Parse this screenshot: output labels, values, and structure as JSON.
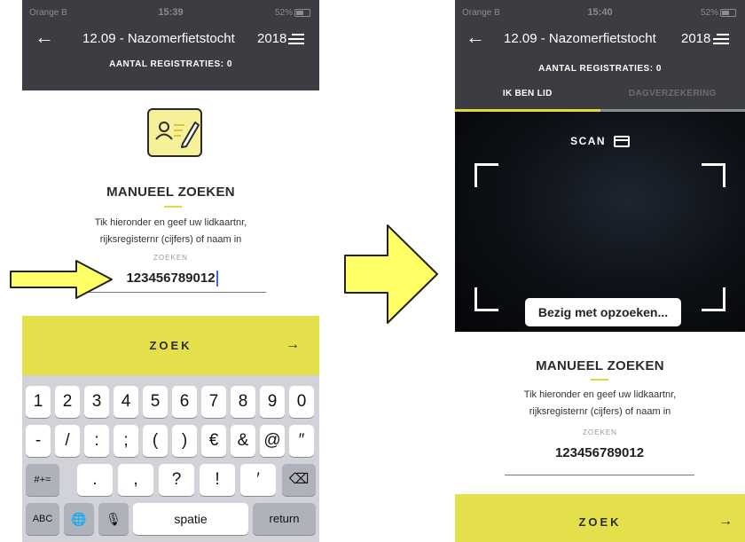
{
  "left_screen": {
    "status_bar": {
      "carrier": "Orange B",
      "time": "15:39",
      "battery": "52%"
    },
    "header": {
      "title": "12.09 - Nazomerfietstocht",
      "year": "2018",
      "registrations": "AANTAL REGISTRATIES: 0"
    },
    "manual_search": {
      "title": "MANUEEL ZOEKEN",
      "help_line1": "Tik hieronder en geef uw lidkaartnr,",
      "help_line2": "rijksregisternr (cijfers) of naam in",
      "field_label": "ZOEKEN",
      "field_value": "123456789012"
    },
    "search_button": {
      "label": "ZOEK",
      "arrow": "→"
    },
    "keyboard": {
      "row1": [
        "1",
        "2",
        "3",
        "4",
        "5",
        "6",
        "7",
        "8",
        "9",
        "0"
      ],
      "row2": [
        "-",
        "/",
        ":",
        ";",
        "(",
        ")",
        "€",
        "&",
        "@",
        "″"
      ],
      "row3": {
        "shift": "#+=",
        "keys": [
          ".",
          ",",
          "?",
          "!",
          "′"
        ],
        "backspace": "⌫"
      },
      "row4": {
        "abc": "ABC",
        "globe": "🌐",
        "mic": "🎙",
        "space": "spatie",
        "return": "return"
      }
    }
  },
  "right_screen": {
    "status_bar": {
      "carrier": "Orange B",
      "time": "15:40",
      "battery": "52%"
    },
    "header": {
      "title": "12.09 - Nazomerfietstocht",
      "year": "2018",
      "registrations": "AANTAL REGISTRATIES: 0"
    },
    "tabs": [
      {
        "label": "IK BEN LID",
        "active": true
      },
      {
        "label": "DAGVERZEKERING",
        "active": false
      }
    ],
    "scanner": {
      "title": "SCAN",
      "status": "Bezig met opzoeken..."
    },
    "manual_search": {
      "title": "MANUEEL ZOEKEN",
      "help_line1": "Tik hieronder en geef uw lidkaartnr,",
      "help_line2": "rijksregisternr (cijfers) of naam in",
      "field_label": "ZOEKEN",
      "field_value": "123456789012"
    },
    "search_button": {
      "label": "ZOEK",
      "arrow": "→"
    }
  },
  "colors": {
    "header": "#3b3d42",
    "accent": "#e3e04c",
    "annotation_arrow": "#ffff66"
  },
  "icons": [
    "back-arrow-icon",
    "menu-icon",
    "member-card-icon",
    "scan-card-icon",
    "backspace-icon",
    "globe-icon",
    "microphone-icon"
  ]
}
